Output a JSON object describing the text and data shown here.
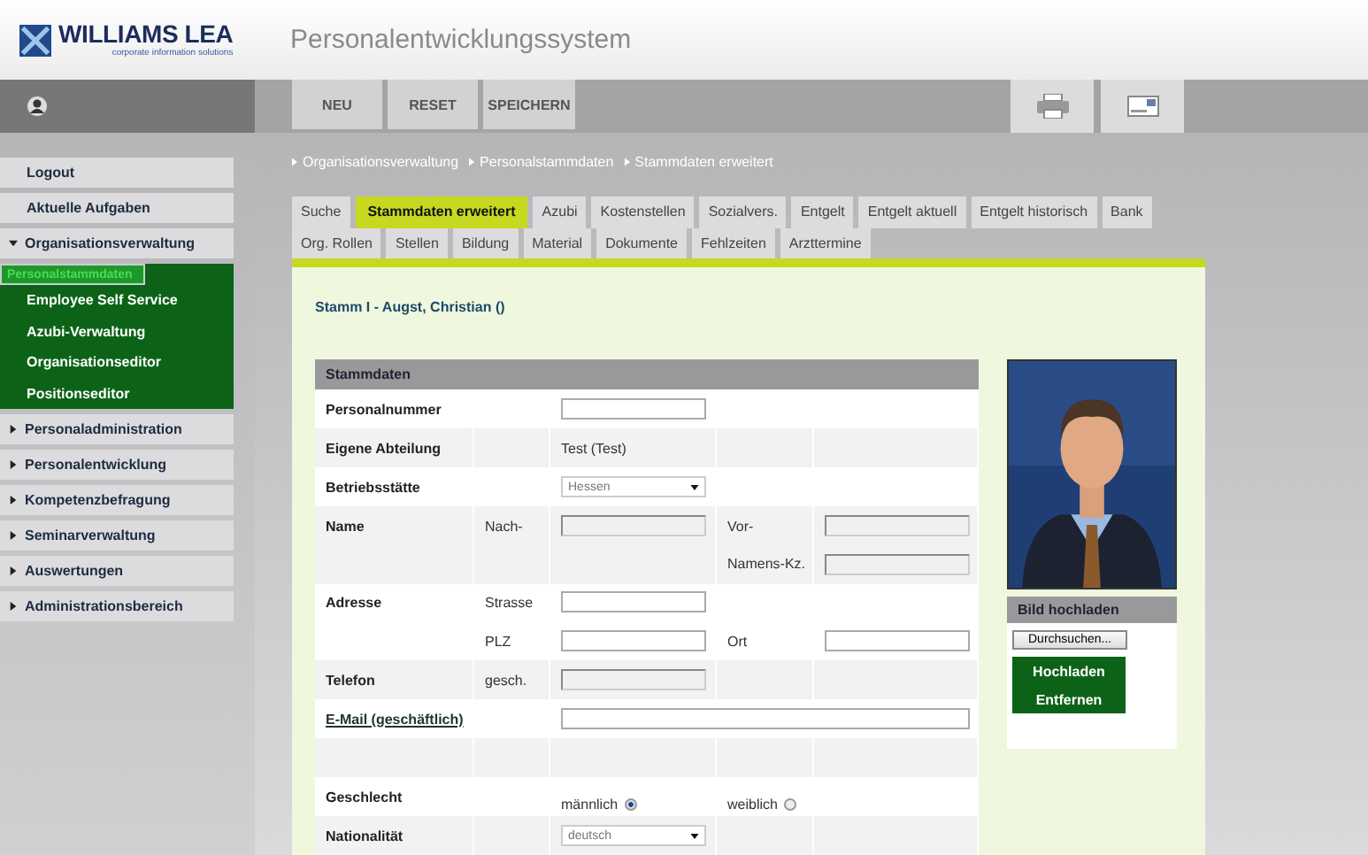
{
  "header": {
    "logo_name": "WILLIAMS LEA",
    "logo_tagline": "corporate information solutions",
    "title": "Personalentwicklungssystem"
  },
  "toolbar": {
    "buttons": [
      "NEU",
      "RESET",
      "SPEICHERN"
    ]
  },
  "sidebar": {
    "items": [
      {
        "kind": "plain",
        "label": "Logout"
      },
      {
        "kind": "plain",
        "label": "Aktuelle Aufgaben"
      },
      {
        "kind": "group",
        "label": "Organisationsverwaltung",
        "expanded": true,
        "children": [
          {
            "label": "Personalstammdaten",
            "selected": true
          },
          {
            "label": "Employee Self Service",
            "selected": false
          },
          {
            "label": "Azubi-Verwaltung",
            "selected": false
          },
          {
            "label": "Organisationseditor",
            "selected": false
          },
          {
            "label": "Positionseditor",
            "selected": false
          }
        ]
      },
      {
        "kind": "group",
        "label": "Personaladministration",
        "expanded": false
      },
      {
        "kind": "group",
        "label": "Personalentwicklung",
        "expanded": false
      },
      {
        "kind": "group",
        "label": "Kompetenzbefragung",
        "expanded": false
      },
      {
        "kind": "group",
        "label": "Seminarverwaltung",
        "expanded": false
      },
      {
        "kind": "group",
        "label": "Auswertungen",
        "expanded": false
      },
      {
        "kind": "group",
        "label": "Administrationsbereich",
        "expanded": false
      }
    ]
  },
  "breadcrumb": [
    "Organisationsverwaltung",
    "Personalstammdaten",
    "Stammdaten erweitert"
  ],
  "tab_rows": [
    [
      {
        "label": "Suche",
        "selected": false
      },
      {
        "label": "Stammdaten erweitert",
        "selected": true
      },
      {
        "label": "Azubi",
        "selected": false
      },
      {
        "label": "Kostenstellen",
        "selected": false
      },
      {
        "label": "Sozialvers.",
        "selected": false
      },
      {
        "label": "Entgelt",
        "selected": false
      },
      {
        "label": "Entgelt aktuell",
        "selected": false
      },
      {
        "label": "Entgelt historisch",
        "selected": false
      },
      {
        "label": "Bank",
        "selected": false
      }
    ],
    [
      {
        "label": "Org. Rollen",
        "selected": false
      },
      {
        "label": "Stellen",
        "selected": false
      },
      {
        "label": "Bildung",
        "selected": false
      },
      {
        "label": "Material",
        "selected": false
      },
      {
        "label": "Dokumente",
        "selected": false
      },
      {
        "label": "Fehlzeiten",
        "selected": false
      },
      {
        "label": "Arzttermine",
        "selected": false
      }
    ]
  ],
  "record_title": "Stamm I - Augst, Christian ()",
  "form": {
    "title": "Stammdaten",
    "rows": [
      {
        "label": "Personalnummer",
        "shaded": false,
        "cells": [
          {
            "kind": "empty"
          },
          {
            "kind": "input",
            "disabled": false
          },
          {
            "kind": "empty"
          },
          {
            "kind": "empty"
          }
        ]
      },
      {
        "label": "Eigene Abteilung",
        "shaded": true,
        "cells": [
          {
            "kind": "empty"
          },
          {
            "kind": "text",
            "text": "Test (Test)"
          },
          {
            "kind": "empty"
          },
          {
            "kind": "empty"
          }
        ]
      },
      {
        "label": "Betriebsstätte",
        "shaded": false,
        "cells": [
          {
            "kind": "empty"
          },
          {
            "kind": "select",
            "value": "Hessen"
          },
          {
            "kind": "empty"
          },
          {
            "kind": "empty"
          }
        ]
      },
      {
        "label": "Name",
        "shaded": true,
        "cells": [
          {
            "kind": "text",
            "text": "Nach-"
          },
          {
            "kind": "input",
            "disabled": true
          },
          {
            "kind": "text",
            "text": "Vor-"
          },
          {
            "kind": "input",
            "disabled": true
          }
        ]
      },
      {
        "shaded": true,
        "cells": [
          {
            "kind": "empty"
          },
          {
            "kind": "empty"
          },
          {
            "kind": "text",
            "text": "Namens-Kz."
          },
          {
            "kind": "input",
            "disabled": true
          }
        ]
      },
      {
        "label": "Adresse",
        "shaded": false,
        "cells": [
          {
            "kind": "text",
            "text": "Strasse"
          },
          {
            "kind": "input",
            "disabled": false
          },
          {
            "kind": "empty"
          },
          {
            "kind": "empty"
          }
        ]
      },
      {
        "shaded": false,
        "cells": [
          {
            "kind": "text",
            "text": "PLZ"
          },
          {
            "kind": "input",
            "disabled": false
          },
          {
            "kind": "text",
            "text": "Ort"
          },
          {
            "kind": "input",
            "disabled": false
          }
        ]
      },
      {
        "label": "Telefon",
        "shaded": true,
        "cells": [
          {
            "kind": "text",
            "text": "gesch."
          },
          {
            "kind": "input",
            "disabled": true
          },
          {
            "kind": "empty"
          },
          {
            "kind": "empty"
          }
        ]
      },
      {
        "label": "E-Mail (geschäftlich)",
        "label_link": true,
        "shaded": false,
        "cells": [
          {
            "kind": "empty"
          },
          {
            "kind": "wide_input"
          }
        ]
      },
      {
        "shaded": true,
        "cells": [
          {
            "kind": "empty"
          },
          {
            "kind": "empty"
          },
          {
            "kind": "empty"
          },
          {
            "kind": "empty"
          }
        ]
      },
      {
        "label": "Geschlecht",
        "shaded": false,
        "cells": [
          {
            "kind": "empty"
          },
          {
            "kind": "radio",
            "label": "männlich",
            "selected": true
          },
          {
            "kind": "radio",
            "label": "weiblich",
            "selected": false
          },
          {
            "kind": "empty"
          }
        ]
      },
      {
        "label": "Nationalität",
        "shaded": true,
        "cells": [
          {
            "kind": "empty"
          },
          {
            "kind": "select",
            "value": "deutsch"
          },
          {
            "kind": "empty"
          },
          {
            "kind": "empty"
          }
        ]
      }
    ]
  },
  "photo_panel": {
    "title": "Bild hochladen",
    "browse_button": "Durchsuchen...",
    "buttons": [
      "Hochladen",
      "Entfernen"
    ]
  }
}
